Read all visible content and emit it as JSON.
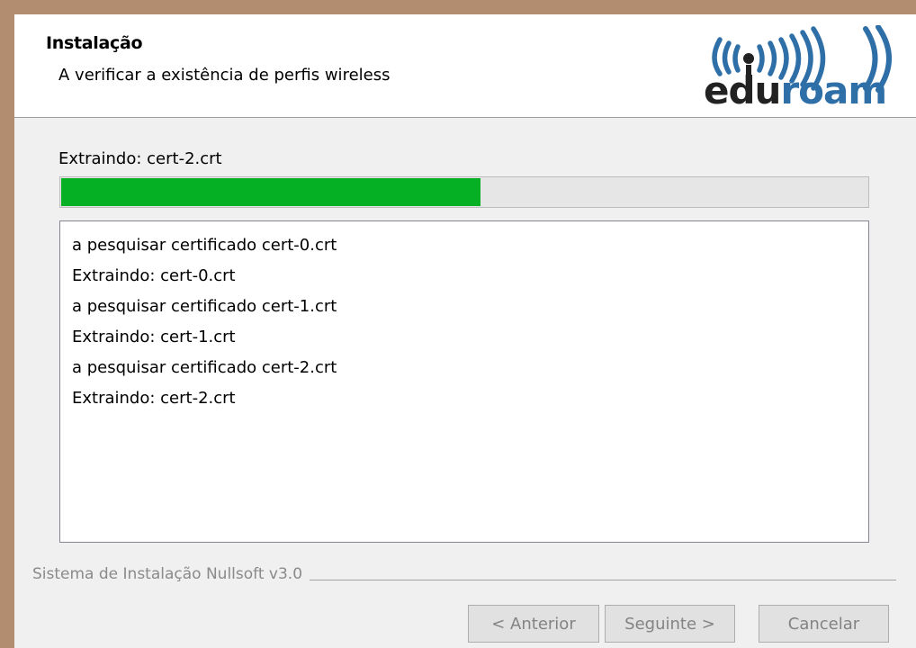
{
  "header": {
    "title": "Instalação",
    "subtitle": "A verificar a existência de perfis wireless",
    "logo": {
      "prefix": "edu",
      "suffix": "roam",
      "prefix_color": "#222222",
      "suffix_color": "#2f6fa7"
    }
  },
  "status_text": "Extraindo: cert-2.crt",
  "progress": {
    "percent": 52,
    "fill_color": "#06b025"
  },
  "log": [
    "a pesquisar certificado cert-0.crt",
    "Extraindo: cert-0.crt",
    "a pesquisar certificado cert-1.crt",
    "Extraindo: cert-1.crt",
    "a pesquisar certificado cert-2.crt",
    "Extraindo: cert-2.crt"
  ],
  "branding": "Sistema de Instalação Nullsoft v3.0",
  "buttons": {
    "back": "< Anterior",
    "next": "Seguinte >",
    "cancel": "Cancelar"
  }
}
